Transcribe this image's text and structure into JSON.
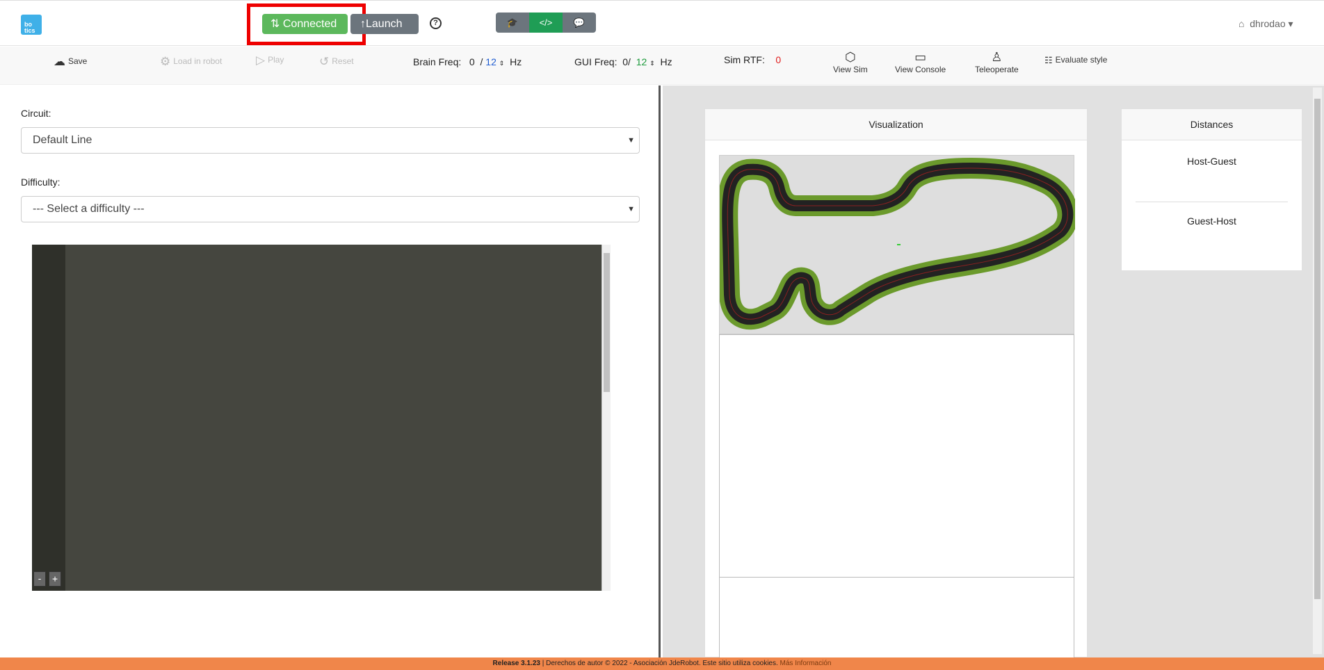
{
  "header": {
    "logo_text": "bo tics",
    "connected_label": "Connected",
    "launch_label": "Launch",
    "help_icon": "question-circle-icon",
    "modes": [
      "mortarboard-icon",
      "code-icon",
      "chat-icon"
    ],
    "user_name": "dhrodao"
  },
  "toolbar": {
    "save_label": "Save",
    "load_label": "Load in robot",
    "play_label": "Play",
    "reset_label": "Reset",
    "brain_freq_label": "Brain Freq:",
    "brain_freq_value": "0",
    "brain_freq_target": "12",
    "gui_freq_label": "GUI Freq:",
    "gui_freq_value": "0/",
    "gui_freq_target": "12",
    "hz": "Hz",
    "sim_rtf_label": "Sim RTF:",
    "sim_rtf_value": "0",
    "view_sim_label": "View Sim",
    "view_console_label": "View Console",
    "teleoperate_label": "Teleoperate",
    "evaluate_label": "Evaluate style"
  },
  "form": {
    "circuit_label": "Circuit:",
    "circuit_value": "Default Line",
    "difficulty_label": "Difficulty:",
    "difficulty_value": "--- Select a difficulty ---"
  },
  "editor": {
    "zoom_out": "-",
    "zoom_in": "+"
  },
  "visualization": {
    "title": "Visualization"
  },
  "distances": {
    "title": "Distances",
    "host_guest": "Host-Guest",
    "guest_host": "Guest-Host"
  },
  "footer": {
    "release": "Release 3.1.23",
    "text": " | Derechos de autor © 2022 - Asociación JdeRobot. Este sitio utiliza cookies. ",
    "more": "Más Información"
  }
}
